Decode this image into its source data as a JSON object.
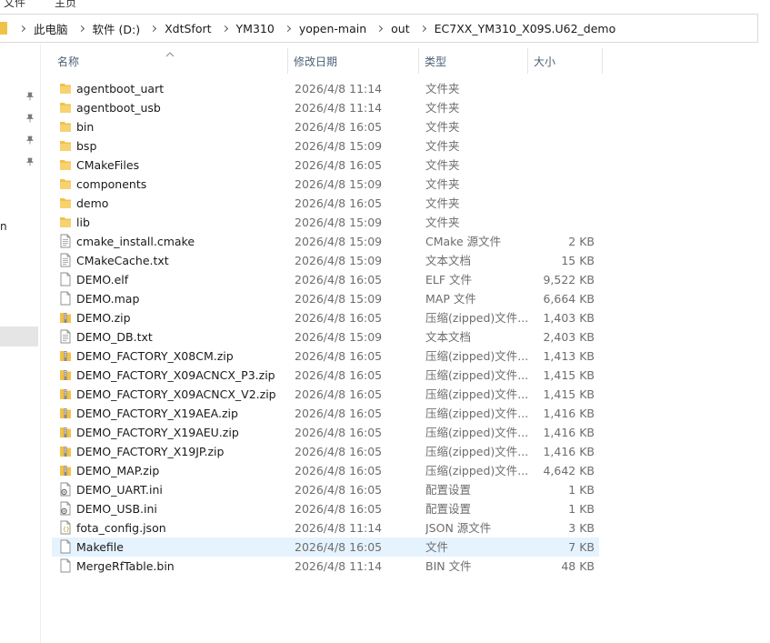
{
  "top_strip": {
    "left": "文件",
    "right": "主页"
  },
  "breadcrumb": [
    "此电脑",
    "软件 (D:)",
    "XdtSfort",
    "YM310",
    "yopen-main",
    "out",
    "EC7XX_YM310_X09S.U62_demo"
  ],
  "nav": {
    "fragment": "n"
  },
  "columns": {
    "name": "名称",
    "date": "修改日期",
    "type": "类型",
    "size": "大小"
  },
  "files": [
    {
      "name": "agentboot_uart",
      "date": "2026/4/8 11:14",
      "type": "文件夹",
      "size": "",
      "icon": "folder-icon"
    },
    {
      "name": "agentboot_usb",
      "date": "2026/4/8 11:14",
      "type": "文件夹",
      "size": "",
      "icon": "folder-icon"
    },
    {
      "name": "bin",
      "date": "2026/4/8 16:05",
      "type": "文件夹",
      "size": "",
      "icon": "folder-icon"
    },
    {
      "name": "bsp",
      "date": "2026/4/8 15:09",
      "type": "文件夹",
      "size": "",
      "icon": "folder-icon"
    },
    {
      "name": "CMakeFiles",
      "date": "2026/4/8 16:05",
      "type": "文件夹",
      "size": "",
      "icon": "folder-icon"
    },
    {
      "name": "components",
      "date": "2026/4/8 15:09",
      "type": "文件夹",
      "size": "",
      "icon": "folder-icon"
    },
    {
      "name": "demo",
      "date": "2026/4/8 16:05",
      "type": "文件夹",
      "size": "",
      "icon": "folder-icon"
    },
    {
      "name": "lib",
      "date": "2026/4/8 15:09",
      "type": "文件夹",
      "size": "",
      "icon": "folder-icon"
    },
    {
      "name": "cmake_install.cmake",
      "date": "2026/4/8 15:09",
      "type": "CMake 源文件",
      "size": "2 KB",
      "icon": "text-file-icon"
    },
    {
      "name": "CMakeCache.txt",
      "date": "2026/4/8 15:09",
      "type": "文本文档",
      "size": "15 KB",
      "icon": "text-file-icon"
    },
    {
      "name": "DEMO.elf",
      "date": "2026/4/8 16:05",
      "type": "ELF 文件",
      "size": "9,522 KB",
      "icon": "blank-file-icon"
    },
    {
      "name": "DEMO.map",
      "date": "2026/4/8 15:09",
      "type": "MAP 文件",
      "size": "6,664 KB",
      "icon": "blank-file-icon"
    },
    {
      "name": "DEMO.zip",
      "date": "2026/4/8 16:05",
      "type": "压缩(zipped)文件...",
      "size": "1,403 KB",
      "icon": "zip-icon"
    },
    {
      "name": "DEMO_DB.txt",
      "date": "2026/4/8 15:09",
      "type": "文本文档",
      "size": "2,403 KB",
      "icon": "text-file-icon"
    },
    {
      "name": "DEMO_FACTORY_X08CM.zip",
      "date": "2026/4/8 16:05",
      "type": "压缩(zipped)文件...",
      "size": "1,413 KB",
      "icon": "zip-icon"
    },
    {
      "name": "DEMO_FACTORY_X09ACNCX_P3.zip",
      "date": "2026/4/8 16:05",
      "type": "压缩(zipped)文件...",
      "size": "1,415 KB",
      "icon": "zip-icon"
    },
    {
      "name": "DEMO_FACTORY_X09ACNCX_V2.zip",
      "date": "2026/4/8 16:05",
      "type": "压缩(zipped)文件...",
      "size": "1,415 KB",
      "icon": "zip-icon"
    },
    {
      "name": "DEMO_FACTORY_X19AEA.zip",
      "date": "2026/4/8 16:05",
      "type": "压缩(zipped)文件...",
      "size": "1,416 KB",
      "icon": "zip-icon"
    },
    {
      "name": "DEMO_FACTORY_X19AEU.zip",
      "date": "2026/4/8 16:05",
      "type": "压缩(zipped)文件...",
      "size": "1,416 KB",
      "icon": "zip-icon"
    },
    {
      "name": "DEMO_FACTORY_X19JP.zip",
      "date": "2026/4/8 16:05",
      "type": "压缩(zipped)文件...",
      "size": "1,416 KB",
      "icon": "zip-icon"
    },
    {
      "name": "DEMO_MAP.zip",
      "date": "2026/4/8 16:05",
      "type": "压缩(zipped)文件...",
      "size": "4,642 KB",
      "icon": "zip-icon"
    },
    {
      "name": "DEMO_UART.ini",
      "date": "2026/4/8 16:05",
      "type": "配置设置",
      "size": "1 KB",
      "icon": "settings-file-icon"
    },
    {
      "name": "DEMO_USB.ini",
      "date": "2026/4/8 16:05",
      "type": "配置设置",
      "size": "1 KB",
      "icon": "settings-file-icon"
    },
    {
      "name": "fota_config.json",
      "date": "2026/4/8 11:14",
      "type": "JSON 源文件",
      "size": "3 KB",
      "icon": "json-file-icon"
    },
    {
      "name": "Makefile",
      "date": "2026/4/8 16:05",
      "type": "文件",
      "size": "7 KB",
      "icon": "blank-file-icon",
      "selected": true
    },
    {
      "name": "MergeRfTable.bin",
      "date": "2026/4/8 11:14",
      "type": "BIN 文件",
      "size": "48 KB",
      "icon": "blank-file-icon"
    }
  ],
  "colors": {
    "folder": "#f0c24a",
    "header_text": "#4c607a",
    "selection": "#e5f3ff",
    "meta_text": "#6d6d6d"
  }
}
